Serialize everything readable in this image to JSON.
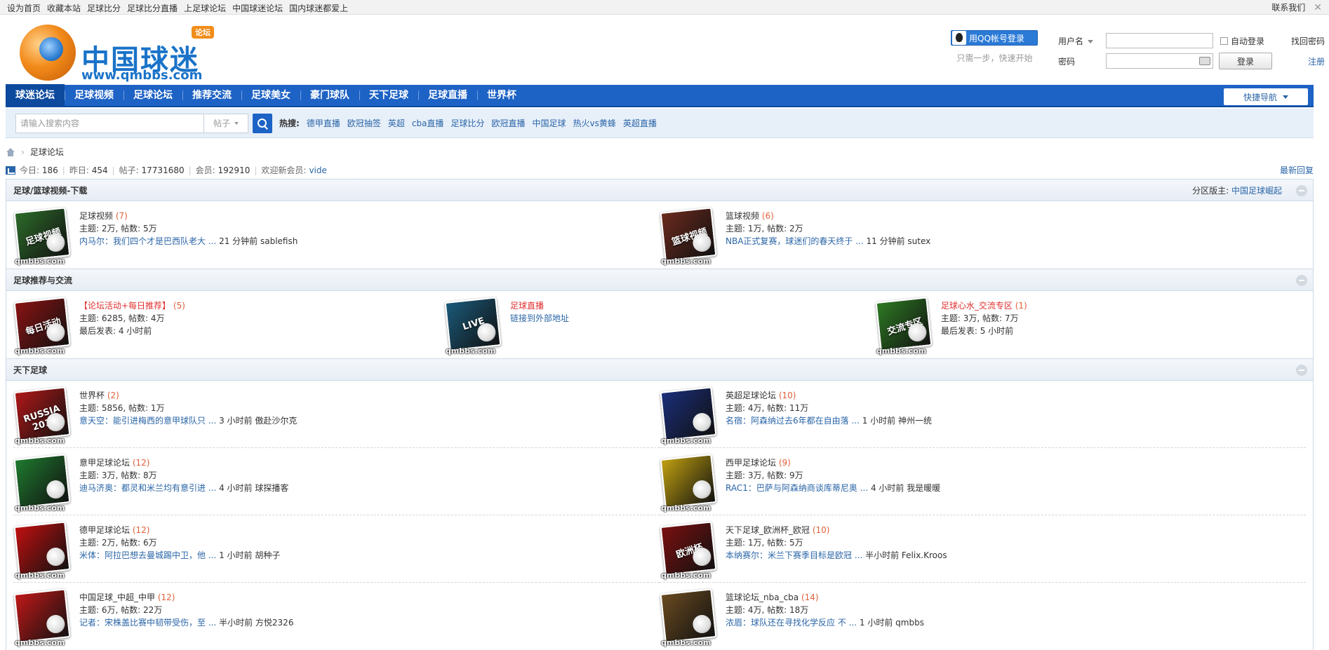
{
  "topbar": {
    "links": [
      "设为首页",
      "收藏本站",
      "足球比分",
      "足球比分直播",
      "上足球论坛",
      "中国球迷论坛",
      "国内球迷都爱上"
    ],
    "contact": "联系我们",
    "close": "✕"
  },
  "logo": {
    "cn": "中国球迷",
    "en": "www.qmbbs.com",
    "badge": "论坛"
  },
  "qq": {
    "button": "用QQ帐号登录",
    "tip": "只需一步，快速开始"
  },
  "login": {
    "username_label": "用户名",
    "password_label": "密码",
    "auto_login": "自动登录",
    "submit": "登录",
    "find_password": "找回密码",
    "register": "注册"
  },
  "nav": {
    "items": [
      "球迷论坛",
      "足球视频",
      "足球论坛",
      "推荐交流",
      "足球美女",
      "豪门球队",
      "天下足球",
      "足球直播",
      "世界杯"
    ],
    "quick": "快捷导航"
  },
  "search": {
    "placeholder": "请输入搜索内容",
    "type": "帖子",
    "hot_label": "热搜:",
    "hot": [
      "德甲直播",
      "欧冠抽签",
      "英超",
      "cba直播",
      "足球比分",
      "欧冠直播",
      "中国足球",
      "热火vs黄蜂",
      "英超直播"
    ]
  },
  "breadcrumb": {
    "current": "足球论坛"
  },
  "stats": {
    "today_label": "今日:",
    "today": "186",
    "yesterday_label": "昨日:",
    "yesterday": "454",
    "posts_label": "帖子:",
    "posts": "17731680",
    "members_label": "会员:",
    "members": "192910",
    "welcome_label": "欢迎新会员:",
    "welcome_user": "vide",
    "latest": "最新回复"
  },
  "sections": [
    {
      "title": "足球/篮球视频-下载",
      "mod_label": "分区版主:",
      "mod_name": "中国足球崛起",
      "forums": [
        {
          "title": "足球视频",
          "count": "(7)",
          "meta": "主题: 2万, 帖数: 5万",
          "last": "内马尔：我们四个才是巴西队老大 ...",
          "time": "21 分钟前 sablefish",
          "cap": "足球视频",
          "color": "#2d6b2a"
        },
        {
          "title": "篮球视频",
          "count": "(6)",
          "meta": "主题: 1万, 帖数: 2万",
          "last": "NBA正式复赛，球迷们的春天终于 ...",
          "time": "11 分钟前 sutex",
          "cap": "篮球视频",
          "color": "#6b2a1e"
        }
      ]
    },
    {
      "title": "足球推荐与交流",
      "forums": [
        {
          "title": "【论坛活动+每日推荐】",
          "count": "(5)",
          "meta": "主题: 6285, 帖数: 4万",
          "last": "最后发表: 4 小时前",
          "cap": "每日活动",
          "color": "#8a1212"
        },
        {
          "title": "足球直播",
          "count": "",
          "meta": "链接到外部地址",
          "last": "",
          "cap": "LIVE",
          "color": "#1a5a7a"
        },
        {
          "title": "足球心水_交流专区",
          "count": "(1)",
          "meta": "主题: 3万, 帖数: 7万",
          "last": "最后发表: 5 小时前",
          "cap": "交流专区",
          "color": "#2e7a24"
        }
      ]
    },
    {
      "title": "天下足球",
      "forums": [
        {
          "title": "世界杯",
          "count": "(2)",
          "meta": "主题: 5856, 帖数: 1万",
          "last": "意天空：能引进梅西的意甲球队只 ...",
          "time": "3 小时前 傲赴沙尔克",
          "cap": "RUSSIA 2018",
          "color": "#b01818"
        },
        {
          "title": "英超足球论坛",
          "count": "(10)",
          "meta": "主题: 4万, 帖数: 11万",
          "last": "名宿：阿森纳过去6年都在自由落 ...",
          "time": "1 小时前 神州一统",
          "cap": "",
          "color": "#1a2e7a"
        },
        {
          "title": "意甲足球论坛",
          "count": "(12)",
          "meta": "主题: 3万, 帖数: 8万",
          "last": "迪马济奥：都灵和米兰均有意引进 ...",
          "time": "4 小时前 球探播客",
          "cap": "",
          "color": "#1f7a2f"
        },
        {
          "title": "西甲足球论坛",
          "count": "(9)",
          "meta": "主题: 3万, 帖数: 9万",
          "last": "RAC1：巴萨与阿森纳商谈库蒂尼奥 ...",
          "time": "4 小时前 我是暖暖",
          "cap": "",
          "color": "#c0a010"
        },
        {
          "title": "德甲足球论坛",
          "count": "(12)",
          "meta": "主题: 2万, 帖数: 6万",
          "last": "米体：阿拉巴想去曼城踢中卫，他 ...",
          "time": "1 小时前 胡种子",
          "cap": "",
          "color": "#c01010"
        },
        {
          "title": "天下足球_欧洲杯_欧冠",
          "count": "(10)",
          "meta": "主题: 1万, 帖数: 5万",
          "last": "本纳赛尔：米兰下赛季目标是欧冠 ...",
          "time": "半小时前 Felix.Kroos",
          "cap": "欧洲杯",
          "color": "#7a1010"
        },
        {
          "title": "中国足球_中超_中甲",
          "count": "(12)",
          "meta": "主题: 6万, 帖数: 22万",
          "last": "记者：宋株盖比赛中韧带受伤，至 ...",
          "time": "半小时前 方悦2326",
          "cap": "",
          "color": "#c01818"
        },
        {
          "title": "篮球论坛_nba_cba",
          "count": "(14)",
          "meta": "主题: 4万, 帖数: 18万",
          "last": "浓眉：球队还在寻找化学反应 不 ...",
          "time": "1 小时前 qmbbs",
          "cap": "",
          "color": "#6a4a20"
        }
      ]
    }
  ],
  "watermark": "qmbbs.com"
}
